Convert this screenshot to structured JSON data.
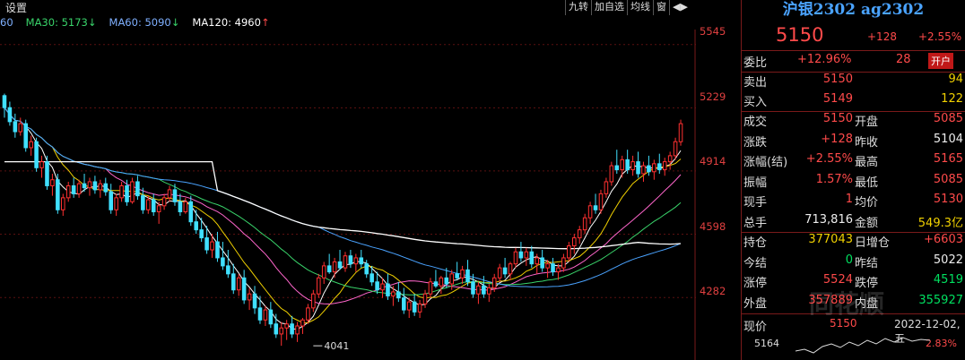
{
  "toolbar": {
    "settings": "设置",
    "tools": [
      "九转",
      "加自选",
      "均线",
      "窗"
    ],
    "arrow": "◀▶"
  },
  "legend": [
    {
      "label": "60",
      "color": "#7fb0ff"
    },
    {
      "label": "MA30: 5173",
      "arrow": "↓",
      "arrow_color": "#00e060",
      "color": "#39d36a"
    },
    {
      "label": "MA60: 5090",
      "arrow": "↓",
      "arrow_color": "#00e060",
      "color": "#7fb0ff"
    },
    {
      "label": "MA120: 4960",
      "arrow": "↑",
      "arrow_color": "#ff4a4a",
      "color": "#ffffff"
    }
  ],
  "chart_data": {
    "type": "candlestick",
    "yticks": [
      5545,
      5229,
      4914,
      4598,
      4282
    ],
    "ylim": [
      3970,
      5620
    ],
    "annotations": [
      {
        "text": "4041",
        "x_index": 58,
        "value": 4041
      }
    ],
    "candles": [
      [
        5290,
        5300,
        5180,
        5230
      ],
      [
        5230,
        5260,
        5140,
        5160
      ],
      [
        5160,
        5200,
        5080,
        5110
      ],
      [
        5110,
        5180,
        5090,
        5150
      ],
      [
        5150,
        5170,
        5010,
        5030
      ],
      [
        5030,
        5090,
        4990,
        5060
      ],
      [
        5060,
        5080,
        4910,
        4930
      ],
      [
        4930,
        4990,
        4880,
        4960
      ],
      [
        4960,
        4990,
        4820,
        4840
      ],
      [
        4840,
        4900,
        4790,
        4870
      ],
      [
        4870,
        4900,
        4700,
        4720
      ],
      [
        4720,
        4800,
        4690,
        4780
      ],
      [
        4780,
        4860,
        4760,
        4840
      ],
      [
        4840,
        4880,
        4780,
        4800
      ],
      [
        4800,
        4870,
        4780,
        4850
      ],
      [
        4850,
        4900,
        4810,
        4830
      ],
      [
        4830,
        4880,
        4790,
        4860
      ],
      [
        4860,
        4890,
        4800,
        4820
      ],
      [
        4820,
        4870,
        4780,
        4850
      ],
      [
        4850,
        4880,
        4790,
        4810
      ],
      [
        4810,
        4850,
        4700,
        4720
      ],
      [
        4720,
        4800,
        4690,
        4780
      ],
      [
        4780,
        4860,
        4760,
        4840
      ],
      [
        4840,
        4870,
        4740,
        4760
      ],
      [
        4760,
        4880,
        4750,
        4860
      ],
      [
        4860,
        4890,
        4770,
        4790
      ],
      [
        4790,
        4830,
        4700,
        4720
      ],
      [
        4720,
        4790,
        4700,
        4770
      ],
      [
        4770,
        4800,
        4690,
        4710
      ],
      [
        4710,
        4760,
        4650,
        4740
      ],
      [
        4740,
        4800,
        4720,
        4780
      ],
      [
        4780,
        4840,
        4760,
        4820
      ],
      [
        4820,
        4850,
        4740,
        4760
      ],
      [
        4760,
        4800,
        4690,
        4710
      ],
      [
        4710,
        4780,
        4700,
        4760
      ],
      [
        4760,
        4790,
        4640,
        4660
      ],
      [
        4660,
        4720,
        4600,
        4620
      ],
      [
        4620,
        4680,
        4560,
        4580
      ],
      [
        4580,
        4640,
        4500,
        4520
      ],
      [
        4520,
        4600,
        4480,
        4560
      ],
      [
        4560,
        4610,
        4460,
        4480
      ],
      [
        4480,
        4560,
        4420,
        4440
      ],
      [
        4440,
        4520,
        4380,
        4400
      ],
      [
        4400,
        4450,
        4300,
        4320
      ],
      [
        4320,
        4400,
        4290,
        4380
      ],
      [
        4380,
        4420,
        4250,
        4270
      ],
      [
        4270,
        4330,
        4220,
        4300
      ],
      [
        4300,
        4340,
        4200,
        4230
      ],
      [
        4230,
        4290,
        4150,
        4170
      ],
      [
        4170,
        4240,
        4140,
        4220
      ],
      [
        4220,
        4260,
        4130,
        4150
      ],
      [
        4150,
        4200,
        4080,
        4100
      ],
      [
        4100,
        4160,
        4041,
        4130
      ],
      [
        4130,
        4170,
        4070,
        4150
      ],
      [
        4150,
        4190,
        4080,
        4100
      ],
      [
        4100,
        4160,
        4060,
        4140
      ],
      [
        4140,
        4180,
        4100,
        4170
      ],
      [
        4170,
        4250,
        4150,
        4230
      ],
      [
        4230,
        4320,
        4210,
        4300
      ],
      [
        4300,
        4400,
        4280,
        4380
      ],
      [
        4380,
        4460,
        4350,
        4440
      ],
      [
        4440,
        4500,
        4400,
        4410
      ],
      [
        4410,
        4480,
        4380,
        4460
      ],
      [
        4460,
        4520,
        4420,
        4430
      ],
      [
        4430,
        4510,
        4410,
        4490
      ],
      [
        4490,
        4520,
        4430,
        4450
      ],
      [
        4450,
        4500,
        4410,
        4480
      ],
      [
        4480,
        4520,
        4430,
        4450
      ],
      [
        4450,
        4470,
        4380,
        4400
      ],
      [
        4400,
        4440,
        4340,
        4360
      ],
      [
        4360,
        4410,
        4300,
        4320
      ],
      [
        4320,
        4380,
        4280,
        4350
      ],
      [
        4350,
        4400,
        4270,
        4290
      ],
      [
        4290,
        4340,
        4240,
        4310
      ],
      [
        4310,
        4360,
        4260,
        4280
      ],
      [
        4280,
        4330,
        4200,
        4220
      ],
      [
        4220,
        4280,
        4180,
        4260
      ],
      [
        4260,
        4300,
        4190,
        4210
      ],
      [
        4210,
        4270,
        4180,
        4250
      ],
      [
        4250,
        4320,
        4230,
        4300
      ],
      [
        4300,
        4380,
        4280,
        4360
      ],
      [
        4360,
        4420,
        4330,
        4340
      ],
      [
        4340,
        4390,
        4300,
        4380
      ],
      [
        4380,
        4430,
        4330,
        4350
      ],
      [
        4350,
        4420,
        4320,
        4400
      ],
      [
        4400,
        4460,
        4370,
        4380
      ],
      [
        4380,
        4440,
        4350,
        4420
      ],
      [
        4420,
        4470,
        4340,
        4360
      ],
      [
        4360,
        4400,
        4280,
        4300
      ],
      [
        4300,
        4360,
        4250,
        4340
      ],
      [
        4340,
        4390,
        4280,
        4300
      ],
      [
        4300,
        4350,
        4260,
        4330
      ],
      [
        4330,
        4400,
        4310,
        4380
      ],
      [
        4380,
        4450,
        4360,
        4430
      ],
      [
        4430,
        4480,
        4380,
        4400
      ],
      [
        4400,
        4460,
        4370,
        4450
      ],
      [
        4450,
        4530,
        4430,
        4510
      ],
      [
        4510,
        4560,
        4460,
        4480
      ],
      [
        4480,
        4530,
        4440,
        4510
      ],
      [
        4510,
        4540,
        4430,
        4450
      ],
      [
        4450,
        4500,
        4400,
        4480
      ],
      [
        4480,
        4520,
        4410,
        4430
      ],
      [
        4430,
        4470,
        4380,
        4450
      ],
      [
        4450,
        4480,
        4390,
        4410
      ],
      [
        4410,
        4450,
        4370,
        4430
      ],
      [
        4430,
        4500,
        4410,
        4480
      ],
      [
        4480,
        4560,
        4460,
        4540
      ],
      [
        4540,
        4600,
        4500,
        4580
      ],
      [
        4580,
        4640,
        4550,
        4620
      ],
      [
        4620,
        4700,
        4600,
        4680
      ],
      [
        4680,
        4760,
        4650,
        4740
      ],
      [
        4740,
        4800,
        4700,
        4720
      ],
      [
        4720,
        4820,
        4700,
        4800
      ],
      [
        4800,
        4880,
        4780,
        4860
      ],
      [
        4860,
        4960,
        4840,
        4940
      ],
      [
        4940,
        5020,
        4900,
        4920
      ],
      [
        4920,
        4990,
        4880,
        4970
      ],
      [
        4970,
        5020,
        4900,
        4920
      ],
      [
        4920,
        4990,
        4890,
        4960
      ],
      [
        4960,
        5010,
        4880,
        4900
      ],
      [
        4900,
        4960,
        4860,
        4940
      ],
      [
        4940,
        4990,
        4890,
        4910
      ],
      [
        4910,
        4970,
        4870,
        4950
      ],
      [
        4950,
        5000,
        4900,
        4920
      ],
      [
        4920,
        4980,
        4890,
        4960
      ],
      [
        4960,
        5010,
        4920,
        4990
      ],
      [
        4990,
        5080,
        4970,
        5060
      ],
      [
        5060,
        5170,
        5040,
        5150
      ]
    ]
  },
  "panel": {
    "title": "沪银2302 ag2302",
    "price": "5150",
    "change": "+128",
    "change_pct": "+2.55%",
    "weibi_label": "委比",
    "weibi_pct": "+12.96%",
    "weibi_val": "28",
    "kaicang": "开户",
    "sell_label": "卖出",
    "sell_price": "5150",
    "sell_vol": "94",
    "buy_label": "买入",
    "buy_price": "5149",
    "buy_vol": "122",
    "rows": [
      {
        "l1": "成交",
        "v1": "5150",
        "c1": "red",
        "l2": "开盘",
        "v2": "5085",
        "c2": "red"
      },
      {
        "l1": "涨跌",
        "v1": "+128",
        "c1": "red",
        "l2": "昨收",
        "v2": "5104",
        "c2": "white"
      },
      {
        "l1": "涨幅(结)",
        "v1": "+2.55%",
        "c1": "red",
        "l2": "最高",
        "v2": "5165",
        "c2": "red"
      },
      {
        "l1": "振幅",
        "v1": "1.57%",
        "c1": "red",
        "l2": "最低",
        "v2": "5085",
        "c2": "red"
      },
      {
        "l1": "现手",
        "v1": "1",
        "c1": "red",
        "l2": "均价",
        "v2": "5130",
        "c2": "red"
      },
      {
        "l1": "总手",
        "v1": "713,816",
        "c1": "white",
        "l2": "金额",
        "v2": "549.3亿",
        "c2": "yellow"
      }
    ],
    "rows2": [
      {
        "l1": "持仓",
        "v1": "377043",
        "c1": "yellow",
        "l2": "日增仓",
        "v2": "+6603",
        "c2": "red"
      },
      {
        "l1": "今结",
        "v1": "0",
        "c1": "green",
        "l2": "昨结",
        "v2": "5022",
        "c2": "white"
      },
      {
        "l1": "涨停",
        "v1": "5524",
        "c1": "red",
        "l2": "跌停",
        "v2": "4519",
        "c2": "green"
      },
      {
        "l1": "外盘",
        "v1": "357889",
        "c1": "red",
        "l2": "内盘",
        "v2": "355927",
        "c2": "green"
      }
    ],
    "mini_now": "现价",
    "mini_price": "5150",
    "mini_date": "2022-12-02,五",
    "mini_low": "5164",
    "mini_pct": "2.83%",
    "watermark": "同花顺"
  }
}
